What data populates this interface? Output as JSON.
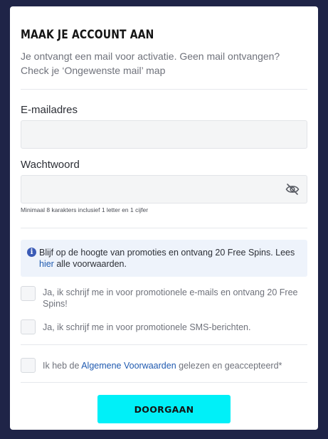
{
  "form": {
    "title": "MAAK JE ACCOUNT AAN",
    "subtitle": "Je ontvangt een mail voor activatie. Geen mail ontvangen? Check je ‘Ongewenste mail’ map",
    "email": {
      "label": "E-mailadres",
      "value": "",
      "placeholder": ""
    },
    "password": {
      "label": "Wachtwoord",
      "value": "",
      "placeholder": "",
      "hint": "Minimaal 8 karakters inclusief 1 letter en 1 cijfer",
      "toggle_icon": "eye-off-icon"
    },
    "info": {
      "icon": "info-icon",
      "icon_glyph": "i",
      "text_before": "Blijf op de hoogte van promoties en ontvang 20 Free Spins. Lees ",
      "link": "hier",
      "text_after": " alle voorwaarden."
    },
    "opt_in_email": "Ja, ik schrijf me in voor promotionele e-mails en ontvang 20 Free Spins!",
    "opt_in_sms": "Ja, ik schrijf me in voor promotionele SMS-berichten.",
    "terms": {
      "before": "Ik heb de ",
      "link": "Algemene Voorwaarden",
      "after": " gelezen en geaccepteerd*"
    },
    "submit_label": "DOORGAAN"
  },
  "colors": {
    "page_background": "#1f2447",
    "accent_button": "#00f0f8",
    "link": "#1f5ab0",
    "info_background": "#eef3fb",
    "info_icon": "#3b5bb6"
  }
}
